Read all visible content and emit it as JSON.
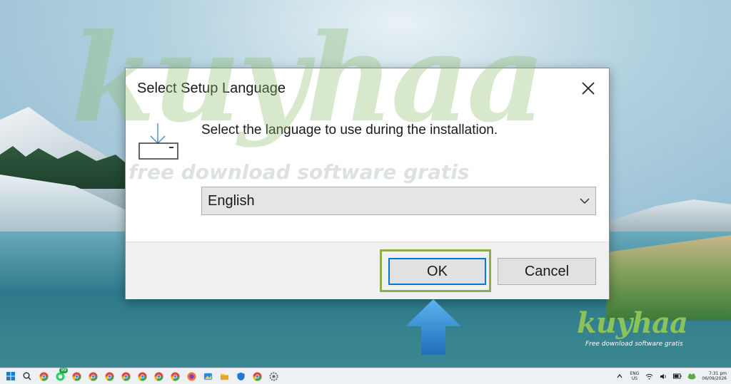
{
  "watermark": {
    "word": "kuyhaa",
    "tagline": "free download software gratis"
  },
  "dialog": {
    "title": "Select Setup Language",
    "prompt": "Select the language to use during the installation.",
    "language_value": "English",
    "ok_label": "OK",
    "cancel_label": "Cancel",
    "icon": "install-download-icon"
  },
  "brand": {
    "word": "kuyhaa",
    "tagline": "Free download software gratis",
    "color": "#8cc25a"
  },
  "taskbar": {
    "badge": "99",
    "language": "ENG",
    "region": "US",
    "time": "7:31 pm",
    "date": "06/09/2026"
  },
  "colors": {
    "focus_blue": "#0078d7",
    "highlight_green": "#8bb04a",
    "arrow_blue": "#2b8fd6"
  }
}
